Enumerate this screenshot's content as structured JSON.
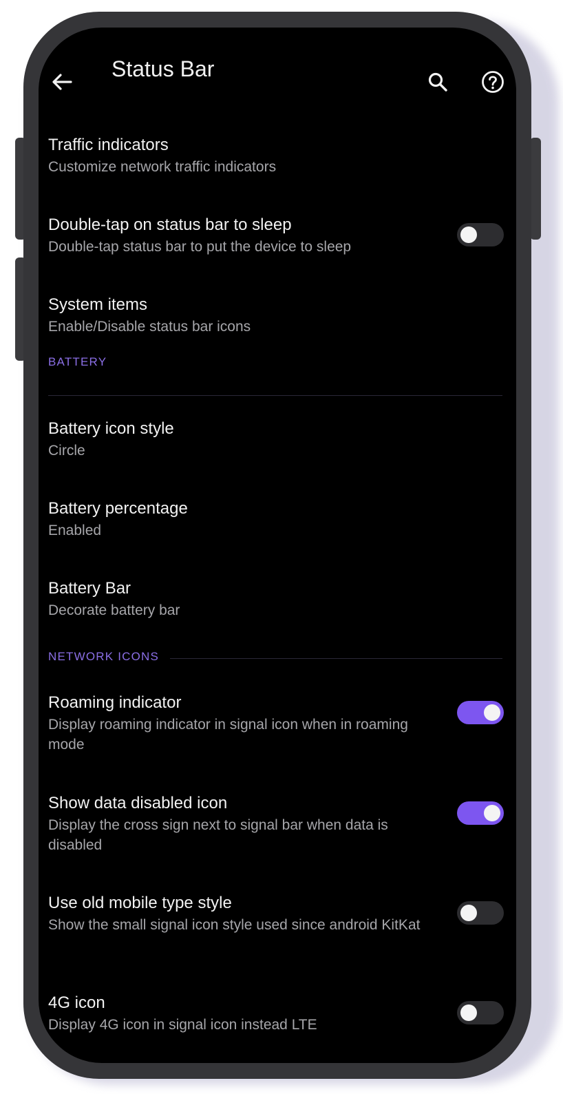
{
  "header": {
    "title": "Status Bar",
    "back_icon": "arrow-left-icon",
    "search_icon": "search-icon",
    "help_icon": "help-circle-icon"
  },
  "colors": {
    "accent": "#7d56f0",
    "category_label": "#8b6fe6",
    "background": "#000000",
    "phone_frame": "#353538"
  },
  "prefs": {
    "traffic": {
      "title": "Traffic indicators",
      "summary": "Customize network traffic indicators"
    },
    "doubletap": {
      "title": "Double-tap on status bar to sleep",
      "summary": "Double-tap status bar to put the device to sleep",
      "enabled": false
    },
    "system_items": {
      "title": "System items",
      "summary": "Enable/Disable status bar icons"
    },
    "battery_style": {
      "title": "Battery icon style",
      "summary": "Circle"
    },
    "battery_percentage": {
      "title": "Battery percentage",
      "summary": "Enabled"
    },
    "battery_bar": {
      "title": "Battery Bar",
      "summary": "Decorate battery bar"
    },
    "roaming": {
      "title": "Roaming indicator",
      "summary": "Display roaming indicator in signal icon when in roaming mode",
      "enabled": true
    },
    "data_disabled": {
      "title": "Show data disabled icon",
      "summary": "Display the cross sign next to signal bar when data is disabled",
      "enabled": true
    },
    "old_mobile": {
      "title": "Use old mobile type style",
      "summary": "Show the small signal icon style used since android KitKat",
      "enabled": false
    },
    "icon_4g": {
      "title": "4G icon",
      "summary": "Display 4G icon in signal icon instead LTE",
      "enabled": false
    }
  },
  "categories": {
    "battery": "BATTERY",
    "network": "NETWORK ICONS"
  }
}
